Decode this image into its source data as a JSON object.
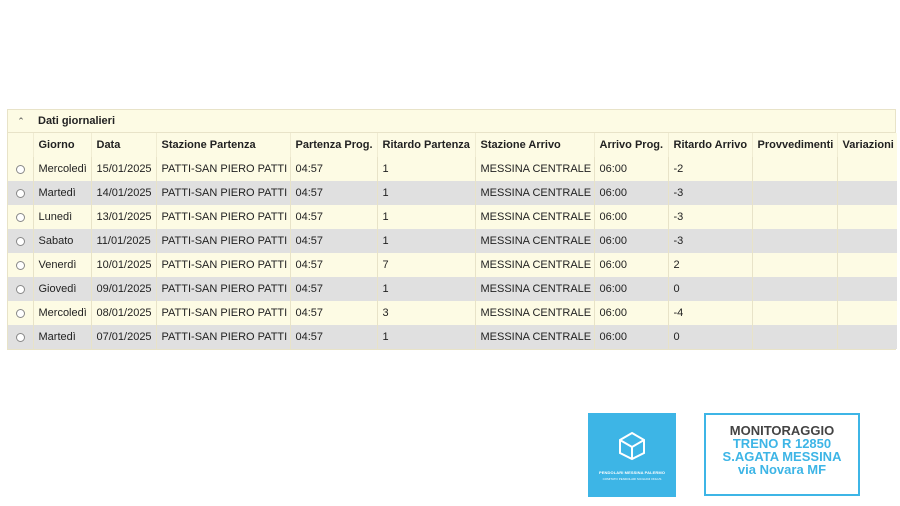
{
  "panel": {
    "title": "Dati giornalieri",
    "toggle_glyph": "⌃"
  },
  "columns": [
    "Giorno",
    "Data",
    "Stazione Partenza",
    "Partenza Prog.",
    "Ritardo Partenza",
    "Stazione Arrivo",
    "Arrivo Prog.",
    "Ritardo Arrivo",
    "Provvedimenti",
    "Variazioni"
  ],
  "rows": [
    {
      "giorno": "Mercoledì",
      "data": "15/01/2025",
      "partenza": "PATTI-SAN PIERO PATTI",
      "partenza_prog": "04:57",
      "ritardo_partenza": "1",
      "arrivo": "MESSINA CENTRALE",
      "arrivo_prog": "06:00",
      "ritardo_arrivo": "-2",
      "provvedimenti": "",
      "variazioni": ""
    },
    {
      "giorno": "Martedì",
      "data": "14/01/2025",
      "partenza": "PATTI-SAN PIERO PATTI",
      "partenza_prog": "04:57",
      "ritardo_partenza": "1",
      "arrivo": "MESSINA CENTRALE",
      "arrivo_prog": "06:00",
      "ritardo_arrivo": "-3",
      "provvedimenti": "",
      "variazioni": ""
    },
    {
      "giorno": "Lunedì",
      "data": "13/01/2025",
      "partenza": "PATTI-SAN PIERO PATTI",
      "partenza_prog": "04:57",
      "ritardo_partenza": "1",
      "arrivo": "MESSINA CENTRALE",
      "arrivo_prog": "06:00",
      "ritardo_arrivo": "-3",
      "provvedimenti": "",
      "variazioni": ""
    },
    {
      "giorno": "Sabato",
      "data": "11/01/2025",
      "partenza": "PATTI-SAN PIERO PATTI",
      "partenza_prog": "04:57",
      "ritardo_partenza": "1",
      "arrivo": "MESSINA CENTRALE",
      "arrivo_prog": "06:00",
      "ritardo_arrivo": "-3",
      "provvedimenti": "",
      "variazioni": ""
    },
    {
      "giorno": "Venerdì",
      "data": "10/01/2025",
      "partenza": "PATTI-SAN PIERO PATTI",
      "partenza_prog": "04:57",
      "ritardo_partenza": "7",
      "arrivo": "MESSINA CENTRALE",
      "arrivo_prog": "06:00",
      "ritardo_arrivo": "2",
      "provvedimenti": "",
      "variazioni": ""
    },
    {
      "giorno": "Giovedì",
      "data": "09/01/2025",
      "partenza": "PATTI-SAN PIERO PATTI",
      "partenza_prog": "04:57",
      "ritardo_partenza": "1",
      "arrivo": "MESSINA CENTRALE",
      "arrivo_prog": "06:00",
      "ritardo_arrivo": "0",
      "provvedimenti": "",
      "variazioni": ""
    },
    {
      "giorno": "Mercoledì",
      "data": "08/01/2025",
      "partenza": "PATTI-SAN PIERO PATTI",
      "partenza_prog": "04:57",
      "ritardo_partenza": "3",
      "arrivo": "MESSINA CENTRALE",
      "arrivo_prog": "06:00",
      "ritardo_arrivo": "-4",
      "provvedimenti": "",
      "variazioni": ""
    },
    {
      "giorno": "Martedì",
      "data": "07/01/2025",
      "partenza": "PATTI-SAN PIERO PATTI",
      "partenza_prog": "04:57",
      "ritardo_partenza": "1",
      "arrivo": "MESSINA CENTRALE",
      "arrivo_prog": "06:00",
      "ritardo_arrivo": "0",
      "provvedimenti": "",
      "variazioni": ""
    }
  ],
  "logo": {
    "icon": "cube-icon",
    "line1": "PENDOLARI MESSINA PALERMO",
    "line2": "COMITATO PENDOLARI SICILIANI ONLUS"
  },
  "monitor": {
    "line1": "MONITORAGGIO",
    "line2": "TRENO R 12850",
    "line3": "S.AGATA  MESSINA",
    "line4": "via Novara MF"
  },
  "colors": {
    "accent": "#3db5e6",
    "row_odd": "#fdfbe4",
    "row_even": "#e0e0e0"
  }
}
